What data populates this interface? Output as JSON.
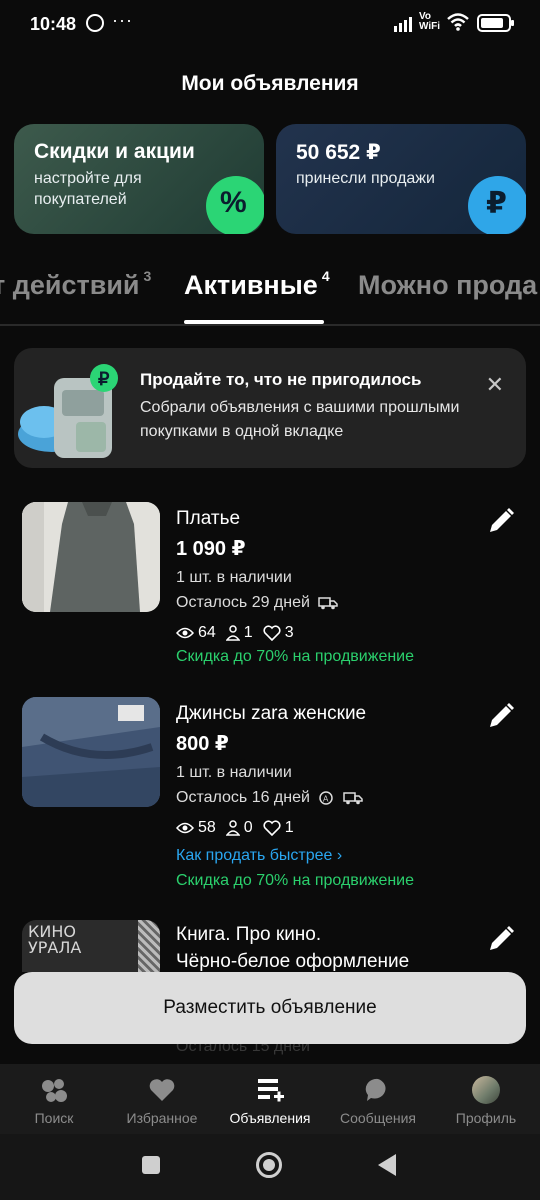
{
  "status_bar": {
    "time": "10:48",
    "more": "···",
    "network_label": "Vo WiFi"
  },
  "header": {
    "title": "Мои объявления"
  },
  "promo_cards": [
    {
      "title": "Скидки и акции",
      "subtitle": "настройте для покупателей",
      "badge_symbol": "%",
      "badge_icon": "percent-icon",
      "accent": "#2bd575"
    },
    {
      "title": "50 652 ₽",
      "subtitle": "принесли продажи",
      "badge_symbol": "₽",
      "badge_icon": "ruble-icon",
      "accent": "#2fa6e8"
    }
  ],
  "tabs": [
    {
      "label": "т действий",
      "count": "3"
    },
    {
      "label": "Активные",
      "count": "4",
      "active": true
    },
    {
      "label": "Можно прода",
      "count": ""
    }
  ],
  "banner": {
    "title": "Продайте то, что не пригодилось",
    "text": "Собрали объявления с вашими прошлыми покупками в одной вкладке"
  },
  "listings": [
    {
      "title": "Платье",
      "price": "1 090 ₽",
      "stock": "1 шт. в наличии",
      "time_left": "Осталось 29 дней",
      "views": "64",
      "contacts": "1",
      "favorites": "3",
      "promo_link": "Скидка до 70% на продвижение"
    },
    {
      "title": "Джинсы zara женские",
      "price": "800 ₽",
      "stock": "1 шт. в наличии",
      "time_left": "Осталось 16 дней",
      "views": "58",
      "contacts": "0",
      "favorites": "1",
      "help_link": "Как продать быстрее",
      "promo_link": "Скидка до 70% на продвижение"
    },
    {
      "title": "Книга. Про кино.",
      "subtitle": "Чёрно-белое оформление",
      "thumb_text": "КИНО УРАЛА",
      "time_left": "Осталось 15 дней"
    }
  ],
  "cta": {
    "label": "Разместить объявление"
  },
  "bottom_nav": [
    {
      "label": "Поиск",
      "icon": "search-icon"
    },
    {
      "label": "Избранное",
      "icon": "heart-icon"
    },
    {
      "label": "Объявления",
      "icon": "listings-icon",
      "active": true
    },
    {
      "label": "Сообщения",
      "icon": "chat-icon"
    },
    {
      "label": "Профиль",
      "icon": "avatar"
    }
  ],
  "colors": {
    "accent_green": "#2bd06d",
    "link_blue": "#2aa6f0",
    "background": "#0b0b0b"
  }
}
